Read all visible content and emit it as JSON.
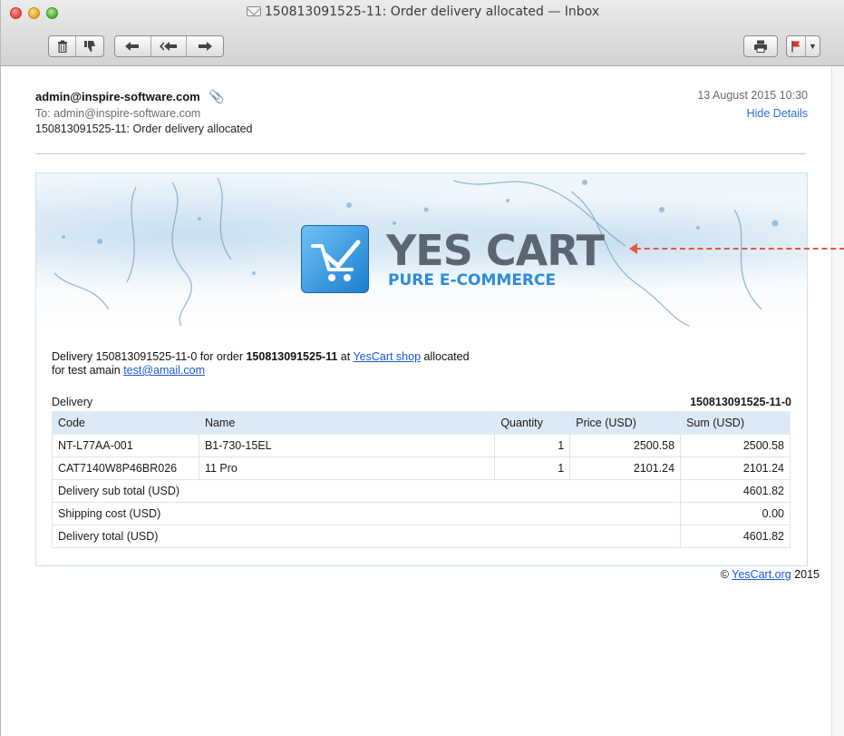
{
  "window": {
    "title": "150813091525-11: Order delivery allocated — Inbox"
  },
  "toolbar": {
    "delete_icon": "trash-icon",
    "junk_icon": "thumbs-down-icon",
    "reply_icon": "reply-icon",
    "reply_all_icon": "reply-all-icon",
    "forward_icon": "forward-icon",
    "print_icon": "printer-icon",
    "flag_icon": "flag-icon",
    "flag_color": "#d9342b"
  },
  "message": {
    "from": "admin@inspire-software.com",
    "to": "To:  admin@inspire-software.com",
    "subject": "150813091525-11: Order delivery allocated",
    "date": "13 August 2015 10:30",
    "hide_details": "Hide Details"
  },
  "body": {
    "logo_main": "YES CART",
    "logo_sub": "PURE E-COMMERCE",
    "intro_prefix": "Delivery 150813091525-11-0 for order ",
    "order_id": "150813091525-11",
    "intro_at": " at ",
    "shop_link": "YesCart shop",
    "intro_suffix": " allocated",
    "line2_prefix": "for test amain ",
    "email_link": "test@amail.com",
    "delivery_label": "Delivery",
    "delivery_id": "150813091525-11-0",
    "table": {
      "headers": [
        "Code",
        "Name",
        "Quantity",
        "Price (USD)",
        "Sum (USD)"
      ],
      "rows": [
        [
          "NT-L77AA-001",
          "B1-730-15EL",
          "1",
          "2500.58",
          "2500.58"
        ],
        [
          "CAT7140W8P46BR026",
          "11 Pro",
          "1",
          "2101.24",
          "2101.24"
        ]
      ],
      "totals": [
        [
          "Delivery sub total (USD)",
          "4601.82"
        ],
        [
          "Shipping cost (USD)",
          "0.00"
        ],
        [
          "Delivery total (USD)",
          "4601.82"
        ]
      ]
    },
    "copyright_prefix": "© ",
    "copyright_link": "YesCart.org",
    "copyright_suffix": " 2015"
  },
  "colors": {
    "link": "#1a58d6",
    "accent": "#2e8bdc",
    "table_header": "#dce9f6",
    "annotation": "#e05a3a"
  }
}
